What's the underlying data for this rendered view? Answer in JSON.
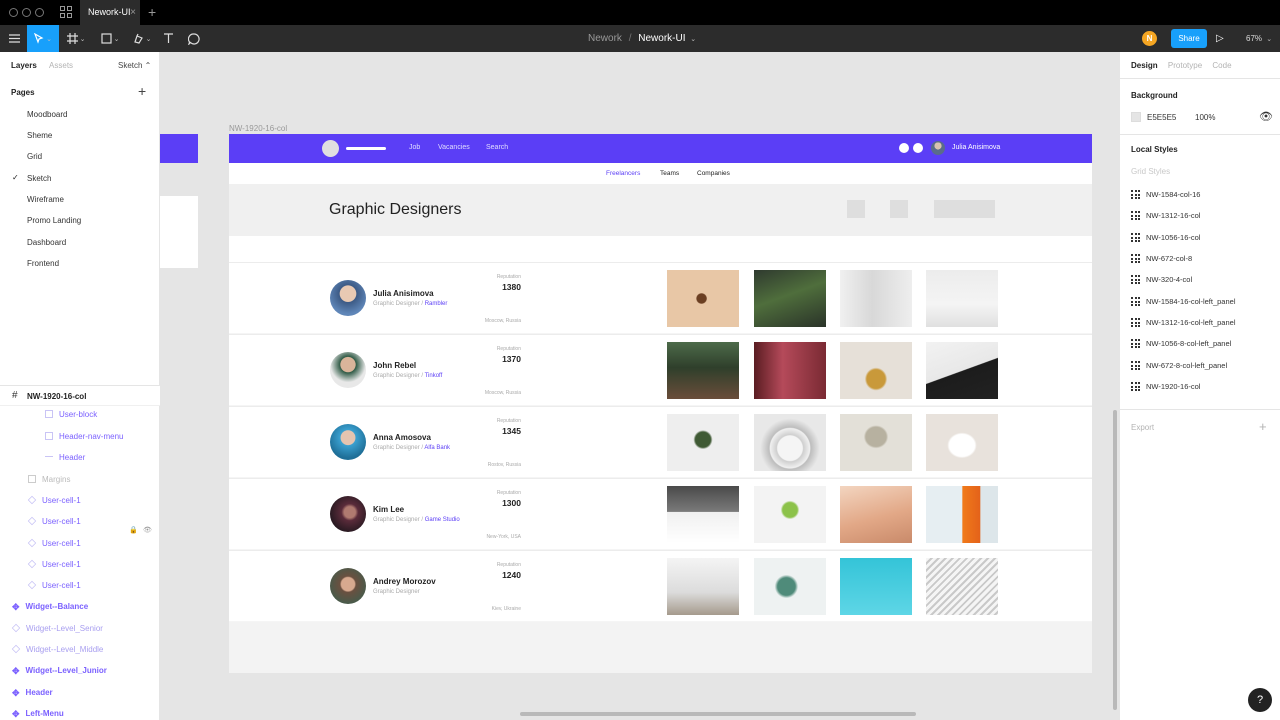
{
  "window": {
    "tab_title": "Nework-UI",
    "tab_close": "×",
    "new_tab": "+"
  },
  "toolbar": {
    "project": "Nework",
    "separator": "/",
    "file": "Nework-UI",
    "file_caret": "⌄",
    "user_initial": "N",
    "share_label": "Share",
    "play_glyph": "▷",
    "zoom": "67%",
    "zoom_caret": "⌄",
    "caret": "⌄"
  },
  "left_panel": {
    "tabs": {
      "layers": "Layers",
      "assets": "Assets"
    },
    "page_selector": "Sketch ⌃",
    "pages_title": "Pages",
    "add_icon": "+",
    "check_glyph": "✓",
    "pages": [
      "Moodboard",
      "Sheme",
      "Grid",
      "Sketch",
      "Wireframe",
      "Promo Landing",
      "Dashboard",
      "Frontend"
    ],
    "current_page": "Sketch",
    "frame_hash": "#",
    "frame_layer": "NW-1920-16-col",
    "layers": [
      {
        "label": "User-block",
        "icon": "rect-icon",
        "style": "purple"
      },
      {
        "label": "Header-nav-menu",
        "icon": "rect-icon",
        "style": "purple"
      },
      {
        "label": "Header",
        "icon": "line-icon",
        "style": "purple"
      },
      {
        "label": "Margins",
        "icon": "rect-icon",
        "style": "gray"
      },
      {
        "label": "User-cell-1",
        "icon": "instance-icon",
        "style": "purple"
      },
      {
        "label": "User-cell-1",
        "icon": "instance-icon",
        "style": "purple"
      },
      {
        "label": "User-cell-1",
        "icon": "instance-icon",
        "style": "purple"
      },
      {
        "label": "User-cell-1",
        "icon": "instance-icon",
        "style": "purple"
      },
      {
        "label": "User-cell-1",
        "icon": "instance-icon",
        "style": "purple"
      },
      {
        "label": "Widget--Balance",
        "icon": "component-icon",
        "style": "purple-bold"
      },
      {
        "label": "Widget--Level_Senior",
        "icon": "instance-icon",
        "style": "faded"
      },
      {
        "label": "Widget--Level_Middle",
        "icon": "instance-icon",
        "style": "faded"
      },
      {
        "label": "Widget--Level_Junior",
        "icon": "component-icon",
        "style": "purple-bold"
      },
      {
        "label": "Header",
        "icon": "component-icon",
        "style": "purple-bold"
      },
      {
        "label": "Left-Menu",
        "icon": "component-icon",
        "style": "purple-bold"
      }
    ],
    "lock_glyph": "🔒",
    "eye_glyph": "👁"
  },
  "canvas": {
    "frame_name": "NW-1920-16-col",
    "header_nav": [
      "Job",
      "Vacancies",
      "Search"
    ],
    "header_user": "Julia Anisimova",
    "subnav": [
      "Freelancers",
      "Teams",
      "Companies"
    ],
    "active_subnav": "Freelancers",
    "page_title": "Graphic Designers",
    "reputation_label": "Reputation",
    "users": [
      {
        "name": "Julia Anisimova",
        "role": "Graphic Designer / ",
        "company": "Rambler",
        "reputation": "1380",
        "location": "Moscow, Russia"
      },
      {
        "name": "John Rebel",
        "role": "Graphic Designer / ",
        "company": "Tinkoff",
        "reputation": "1370",
        "location": "Moscow, Russia"
      },
      {
        "name": "Anna Amosova",
        "role": "Graphic Designer / ",
        "company": "Alfa Bank",
        "reputation": "1345",
        "location": "Rostov, Russia"
      },
      {
        "name": "Kim Lee",
        "role": "Graphic Designer / ",
        "company": "Game Studio",
        "reputation": "1300",
        "location": "New-York, USA"
      },
      {
        "name": "Andrey Morozov",
        "role": "Graphic Designer",
        "company": "",
        "reputation": "1240",
        "location": "Kiev, Ukraine"
      }
    ],
    "colors": {
      "brand": "#5b3ef6",
      "figma_blue": "#18a0fb",
      "canvas_bg": "#e5e5e5"
    }
  },
  "right_panel": {
    "tabs": {
      "design": "Design",
      "prototype": "Prototype",
      "code": "Code"
    },
    "background_title": "Background",
    "background_hex": "E5E5E5",
    "background_opacity": "100%",
    "visibility_glyph": "👁",
    "local_styles_title": "Local Styles",
    "grid_styles_label": "Grid Styles",
    "grid_styles": [
      "NW-1584-col-16",
      "NW-1312-16-col",
      "NW-1056-16-col",
      "NW-672-col-8",
      "NW-320-4-col",
      "NW-1584-16-col-left_panel",
      "NW-1312-16-col-left_panel",
      "NW-1056-8-col-left_panel",
      "NW-672-8-col-left_panel",
      "NW-1920-16-col"
    ],
    "export_label": "Export",
    "export_add": "+"
  },
  "help_glyph": "?"
}
